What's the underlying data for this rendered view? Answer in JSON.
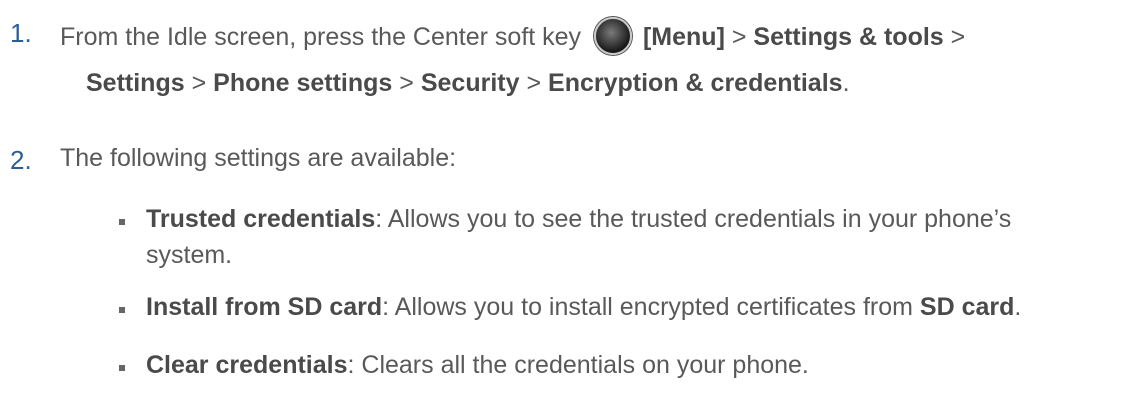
{
  "step1": {
    "number": "1.",
    "line1_pre": "From the Idle screen, press the Center soft key",
    "icon": "center-soft-key-icon",
    "menu": "[Menu]",
    "sep": ">",
    "path": [
      "Settings & tools",
      "Settings",
      "Phone settings",
      "Security",
      "Encryption & credentials"
    ],
    "end": "."
  },
  "step2": {
    "number": "2.",
    "text": "The following settings are available:"
  },
  "settings": [
    {
      "name": "Trusted credentials",
      "desc_line1": ": Allows you to see the trusted credentials in your phone’s",
      "desc_line2": "system."
    },
    {
      "name": "Install from SD card",
      "desc_mid": ": Allows you to install encrypted certificates from ",
      "desc_bold": "SD card",
      "desc_end": "."
    },
    {
      "name": "Clear credentials",
      "desc": ": Clears all the credentials on your phone."
    }
  ]
}
